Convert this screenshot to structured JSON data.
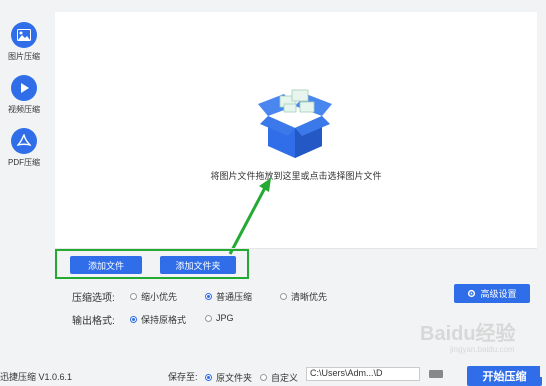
{
  "sidebar": {
    "items": [
      {
        "label": "图片压缩",
        "icon": "image-icon"
      },
      {
        "label": "视频压缩",
        "icon": "play-icon"
      },
      {
        "label": "PDF压缩",
        "icon": "pdf-icon"
      }
    ]
  },
  "dropzone": {
    "text": "将图片文件拖放到这里或点击选择图片文件",
    "icon": "open-box-icon"
  },
  "buttons": {
    "add_file": "添加文件",
    "add_folder": "添加文件夹",
    "advanced": "高级设置",
    "start": "开始压缩"
  },
  "compress": {
    "label": "压缩选项:",
    "options": [
      "缩小优先",
      "普通压缩",
      "清晰优先"
    ],
    "selected": "普通压缩"
  },
  "format": {
    "label": "输出格式:",
    "options": [
      "保持原格式",
      "JPG"
    ],
    "selected": "保持原格式"
  },
  "footer": {
    "version": "迅捷压缩 V1.0.6.1",
    "save_label": "保存至:",
    "save_options": [
      "原文件夹",
      "自定义"
    ],
    "path": "C:\\Users\\Adm...\\D"
  },
  "watermark": {
    "text": "Baidu经验",
    "sub": "jingyan.baidu.com"
  },
  "colors": {
    "accent": "#2f6ee8",
    "highlight": "#22aa33"
  }
}
